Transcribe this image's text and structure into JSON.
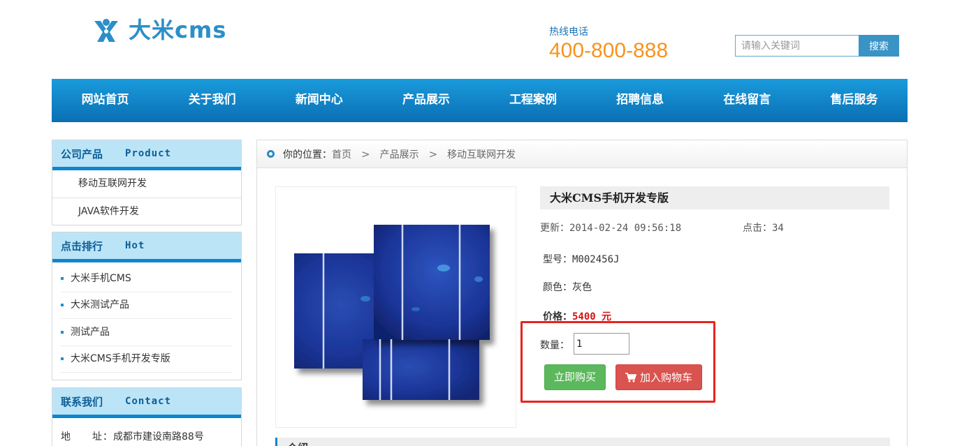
{
  "header": {
    "logo_text": "大米cms",
    "hotline_label": "热线电话",
    "hotline_number": "400-800-888",
    "search_placeholder": "请输入关键词",
    "search_button": "搜索"
  },
  "nav": {
    "items": [
      "网站首页",
      "关于我们",
      "新闻中心",
      "产品展示",
      "工程案例",
      "招聘信息",
      "在线留言",
      "售后服务"
    ]
  },
  "sidebar": {
    "products": {
      "title_cn": "公司产品",
      "title_en": "Product",
      "items": [
        "移动互联网开发",
        "JAVA软件开发"
      ]
    },
    "hot": {
      "title_cn": "点击排行",
      "title_en": "Hot",
      "items": [
        "大米手机CMS",
        "大米测试产品",
        "测试产品",
        "大米CMS手机开发专版"
      ]
    },
    "contact": {
      "title_cn": "联系我们",
      "title_en": "Contact",
      "address_label": "地　　址：",
      "address_value": "成都市建设南路88号"
    }
  },
  "breadcrumb": {
    "prefix": "你的位置：",
    "items": [
      "首页",
      "产品展示",
      "移动互联网开发"
    ],
    "separator": ">"
  },
  "product": {
    "title": "大米CMS手机开发专版",
    "updated_label": "更新：",
    "updated_value": "2014-02-24 09:56:18",
    "views_label": "点击：",
    "views_value": "34",
    "model_label": "型号：",
    "model_value": "M002456J",
    "color_label": "颜色：",
    "color_value": "灰色",
    "price_label": "价格：",
    "price_value": "5400 元",
    "qty_label": "数量：",
    "qty_value": "1",
    "buy_now": "立即购买",
    "add_to_cart": "加入购物车",
    "intro_tab": "介绍"
  },
  "colors": {
    "nav_blue": "#0b86cf",
    "hotline_orange": "#f7931e",
    "price_red": "#d31515",
    "buy_green": "#5cb85c",
    "cart_red": "#d9534f",
    "highlight_red": "#e8231d"
  }
}
